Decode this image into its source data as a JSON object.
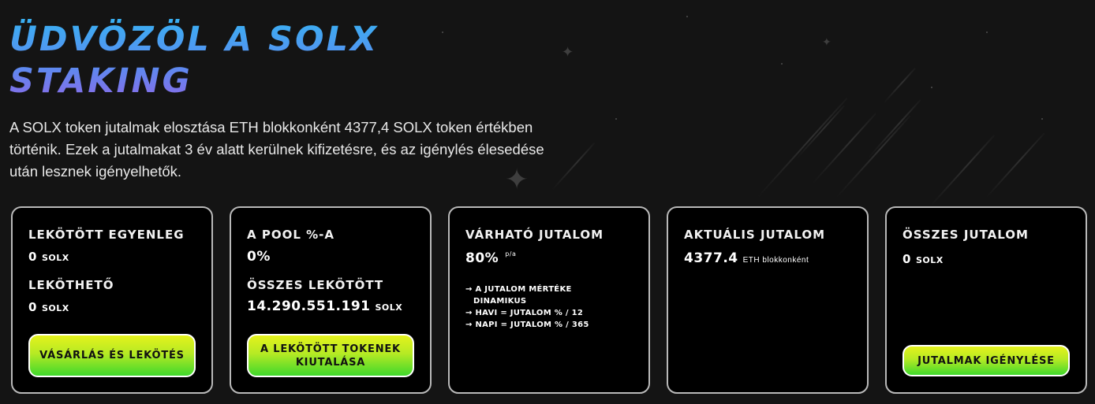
{
  "header": {
    "title_line1": "ÜDVÖZÖL A SOLX",
    "title_line2": "STAKING",
    "intro": "A SOLX token jutalmak elosztása ETH blokkonként 4377,4 SOLX token értékben történik. Ezek a jutalmakat 3 év alatt kerülnek kifizetésre, és az igénylés élesedése után lesznek igényelhetők."
  },
  "cards": {
    "staked": {
      "label1": "LEKÖTÖTT EGYENLEG",
      "value1": "0",
      "unit1": "SOLX",
      "label2": "LEKÖTHETŐ",
      "value2": "0",
      "unit2": "SOLX",
      "button": "VÁSÁRLÁS ÉS LEKÖTÉS"
    },
    "pool": {
      "label1": "A POOL %-A",
      "value1": "0%",
      "label2": "ÖSSZES LEKÖTÖTT",
      "value2": "14.290.551.191",
      "unit2": "SOLX",
      "button": "A LEKÖTÖTT TOKENEK KIUTALÁSA"
    },
    "expected": {
      "label": "VÁRHATÓ JUTALOM",
      "value": "80%",
      "suffix": "p/a",
      "note1a": "→ A JUTALOM MÉRTÉKE",
      "note1b": "DINAMIKUS",
      "note2": "→ HAVI = JUTALOM % / 12",
      "note3": "→ NAPI = JUTALOM % / 365"
    },
    "current": {
      "label": "AKTUÁLIS JUTALOM",
      "value": "4377.4",
      "unit": "ETH blokkonként"
    },
    "total": {
      "label": "ÖSSZES JUTALOM",
      "value": "0",
      "unit": "SOLX",
      "button": "JUTALMAK IGÉNYLÉSE"
    }
  },
  "colors": {
    "background": "#141414",
    "card_border": "#b9b9b9",
    "button_top": "#e4f21c",
    "button_bottom": "#3fd82c",
    "title_top": "#39b0f2",
    "title_bottom": "#8a6ae8"
  }
}
